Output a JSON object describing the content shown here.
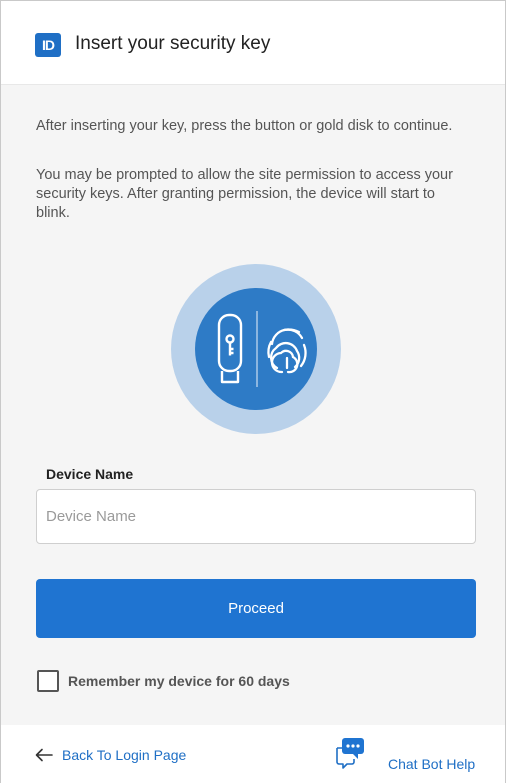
{
  "header": {
    "logo_text": "ID",
    "title": "Insert your security key"
  },
  "instructions": {
    "line1": "After inserting your key, press the button or gold disk to continue.",
    "line2": "You may be prompted to allow the site permission to access your security keys. After granting permission, the device will start to blink."
  },
  "illustration": {
    "icons": [
      "usb-key-icon",
      "fingerprint-icon"
    ],
    "colors": {
      "outer": "#b9d1ea",
      "inner": "#2e7bc6"
    }
  },
  "form": {
    "device_name_label": "Device Name",
    "device_name_placeholder": "Device Name",
    "device_name_value": "",
    "proceed_label": "Proceed",
    "remember_label": "Remember my device for 60 days",
    "remember_checked": false
  },
  "footer": {
    "back_label": "Back To Login Page",
    "chat_label": "Chat Bot Help"
  },
  "colors": {
    "accent": "#1f74d1",
    "link": "#1f6fc5",
    "background": "#f5f5f5"
  }
}
